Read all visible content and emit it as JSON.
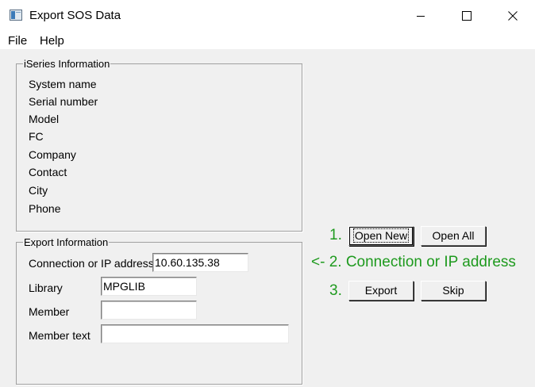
{
  "window": {
    "title": "Export SOS Data"
  },
  "menu": {
    "file": "File",
    "help": "Help"
  },
  "iseries": {
    "legend": "iSeries Information",
    "fields": [
      "System name",
      "Serial number",
      "Model",
      "FC",
      "Company",
      "Contact",
      "City",
      "Phone"
    ]
  },
  "export": {
    "legend": "Export Information",
    "connection_label": "Connection or IP address",
    "connection_value": "10.60.135.38",
    "library_label": "Library",
    "library_value": "MPGLIB",
    "member_label": "Member",
    "member_value": "",
    "member_text_label": "Member text",
    "member_text_value": ""
  },
  "steps": {
    "step1": "1.",
    "step2": "<- 2. Connection or IP address",
    "step3": "3."
  },
  "buttons": {
    "open_new": "Open New",
    "open_all": "Open All",
    "export": "Export",
    "skip": "Skip"
  },
  "colors": {
    "step_text": "#1e9a1e",
    "background": "#f0f0f0"
  }
}
